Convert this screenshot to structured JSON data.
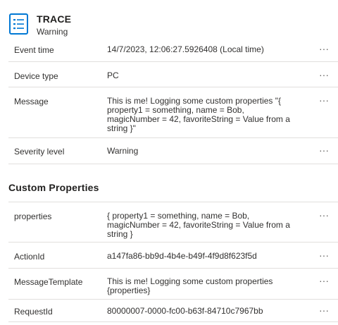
{
  "header": {
    "title": "TRACE",
    "subtitle": "Warning",
    "icon": "list-icon",
    "icon_color": "#0078d4"
  },
  "details": [
    {
      "key": "Event time",
      "value": "14/7/2023, 12:06:27.5926408 (Local time)"
    },
    {
      "key": "Device type",
      "value": "PC"
    },
    {
      "key": "Message",
      "value": "This is me! Logging some custom properties \"{ property1 = something, name = Bob, magicNumber = 42, favoriteString = Value from a string }\""
    },
    {
      "key": "Severity level",
      "value": "Warning"
    }
  ],
  "custom_properties": {
    "title": "Custom Properties",
    "items": [
      {
        "key": "properties",
        "value": "{ property1 = something, name = Bob, magicNumber = 42, favoriteString = Value from a string }"
      },
      {
        "key": "ActionId",
        "value": "a147fa86-bb9d-4b4e-b49f-4f9d8f623f5d"
      },
      {
        "key": "MessageTemplate",
        "value": "This is me! Logging some custom properties {properties}"
      },
      {
        "key": "RequestId",
        "value": "80000007-0000-fc00-b63f-84710c7967bb"
      }
    ]
  },
  "more_label": "···"
}
